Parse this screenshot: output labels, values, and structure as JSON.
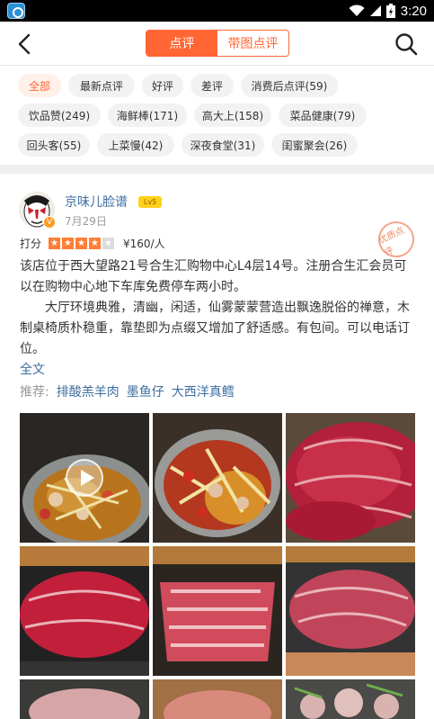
{
  "status_bar": {
    "time": "3:20"
  },
  "header": {
    "tab_reviews": "点评",
    "tab_photo_reviews": "带图点评"
  },
  "tags": [
    {
      "label": "全部",
      "active": true
    },
    {
      "label": "最新点评"
    },
    {
      "label": "好评"
    },
    {
      "label": "差评"
    },
    {
      "label": "消费后点评(59)"
    },
    {
      "label": "饮品赞(249)"
    },
    {
      "label": "海鲜棒(171)"
    },
    {
      "label": "高大上(158)"
    },
    {
      "label": "菜品健康(79)"
    },
    {
      "label": "回头客(55)"
    },
    {
      "label": "上菜慢(42)"
    },
    {
      "label": "深夜食堂(31)"
    },
    {
      "label": "闺蜜聚会(26)"
    }
  ],
  "review": {
    "username": "京味儿脸谱",
    "level": "Lv5",
    "avatar_badge": "V",
    "date": "7月29日",
    "stamp": "优质点评",
    "score_label": "打分",
    "rating": 4,
    "rating_max": 5,
    "price": "¥160/人",
    "body_p1": "该店位于西大望路21号合生汇购物中心L4层14号。注册合生汇会员可以在购物中心地下车库免费停车两小时。",
    "body_p2": "大厅环境典雅，清幽，闲适，仙雾蒙蒙营造出飘逸脱俗的禅意，木制桌椅质朴稳重，靠垫即为点缀又增加了舒适感。有包间。可以电话订位。",
    "more": "全文",
    "recommend_label": "推荐:",
    "dishes": [
      "排酸羔羊肉",
      "墨鱼仔",
      "大西洋真鳕"
    ]
  },
  "photos": [
    {
      "kind": "hotpot-video",
      "has_play": true
    },
    {
      "kind": "hotpot"
    },
    {
      "kind": "lamb-slices"
    },
    {
      "kind": "lamb-slices"
    },
    {
      "kind": "lamb-slices"
    },
    {
      "kind": "lamb-slices"
    },
    {
      "kind": "platter"
    },
    {
      "kind": "platter"
    },
    {
      "kind": "seafood"
    }
  ],
  "colors": {
    "accent": "#ff6633",
    "link": "#3d6e9f",
    "muted": "#999999",
    "star": "#ff7e36"
  }
}
